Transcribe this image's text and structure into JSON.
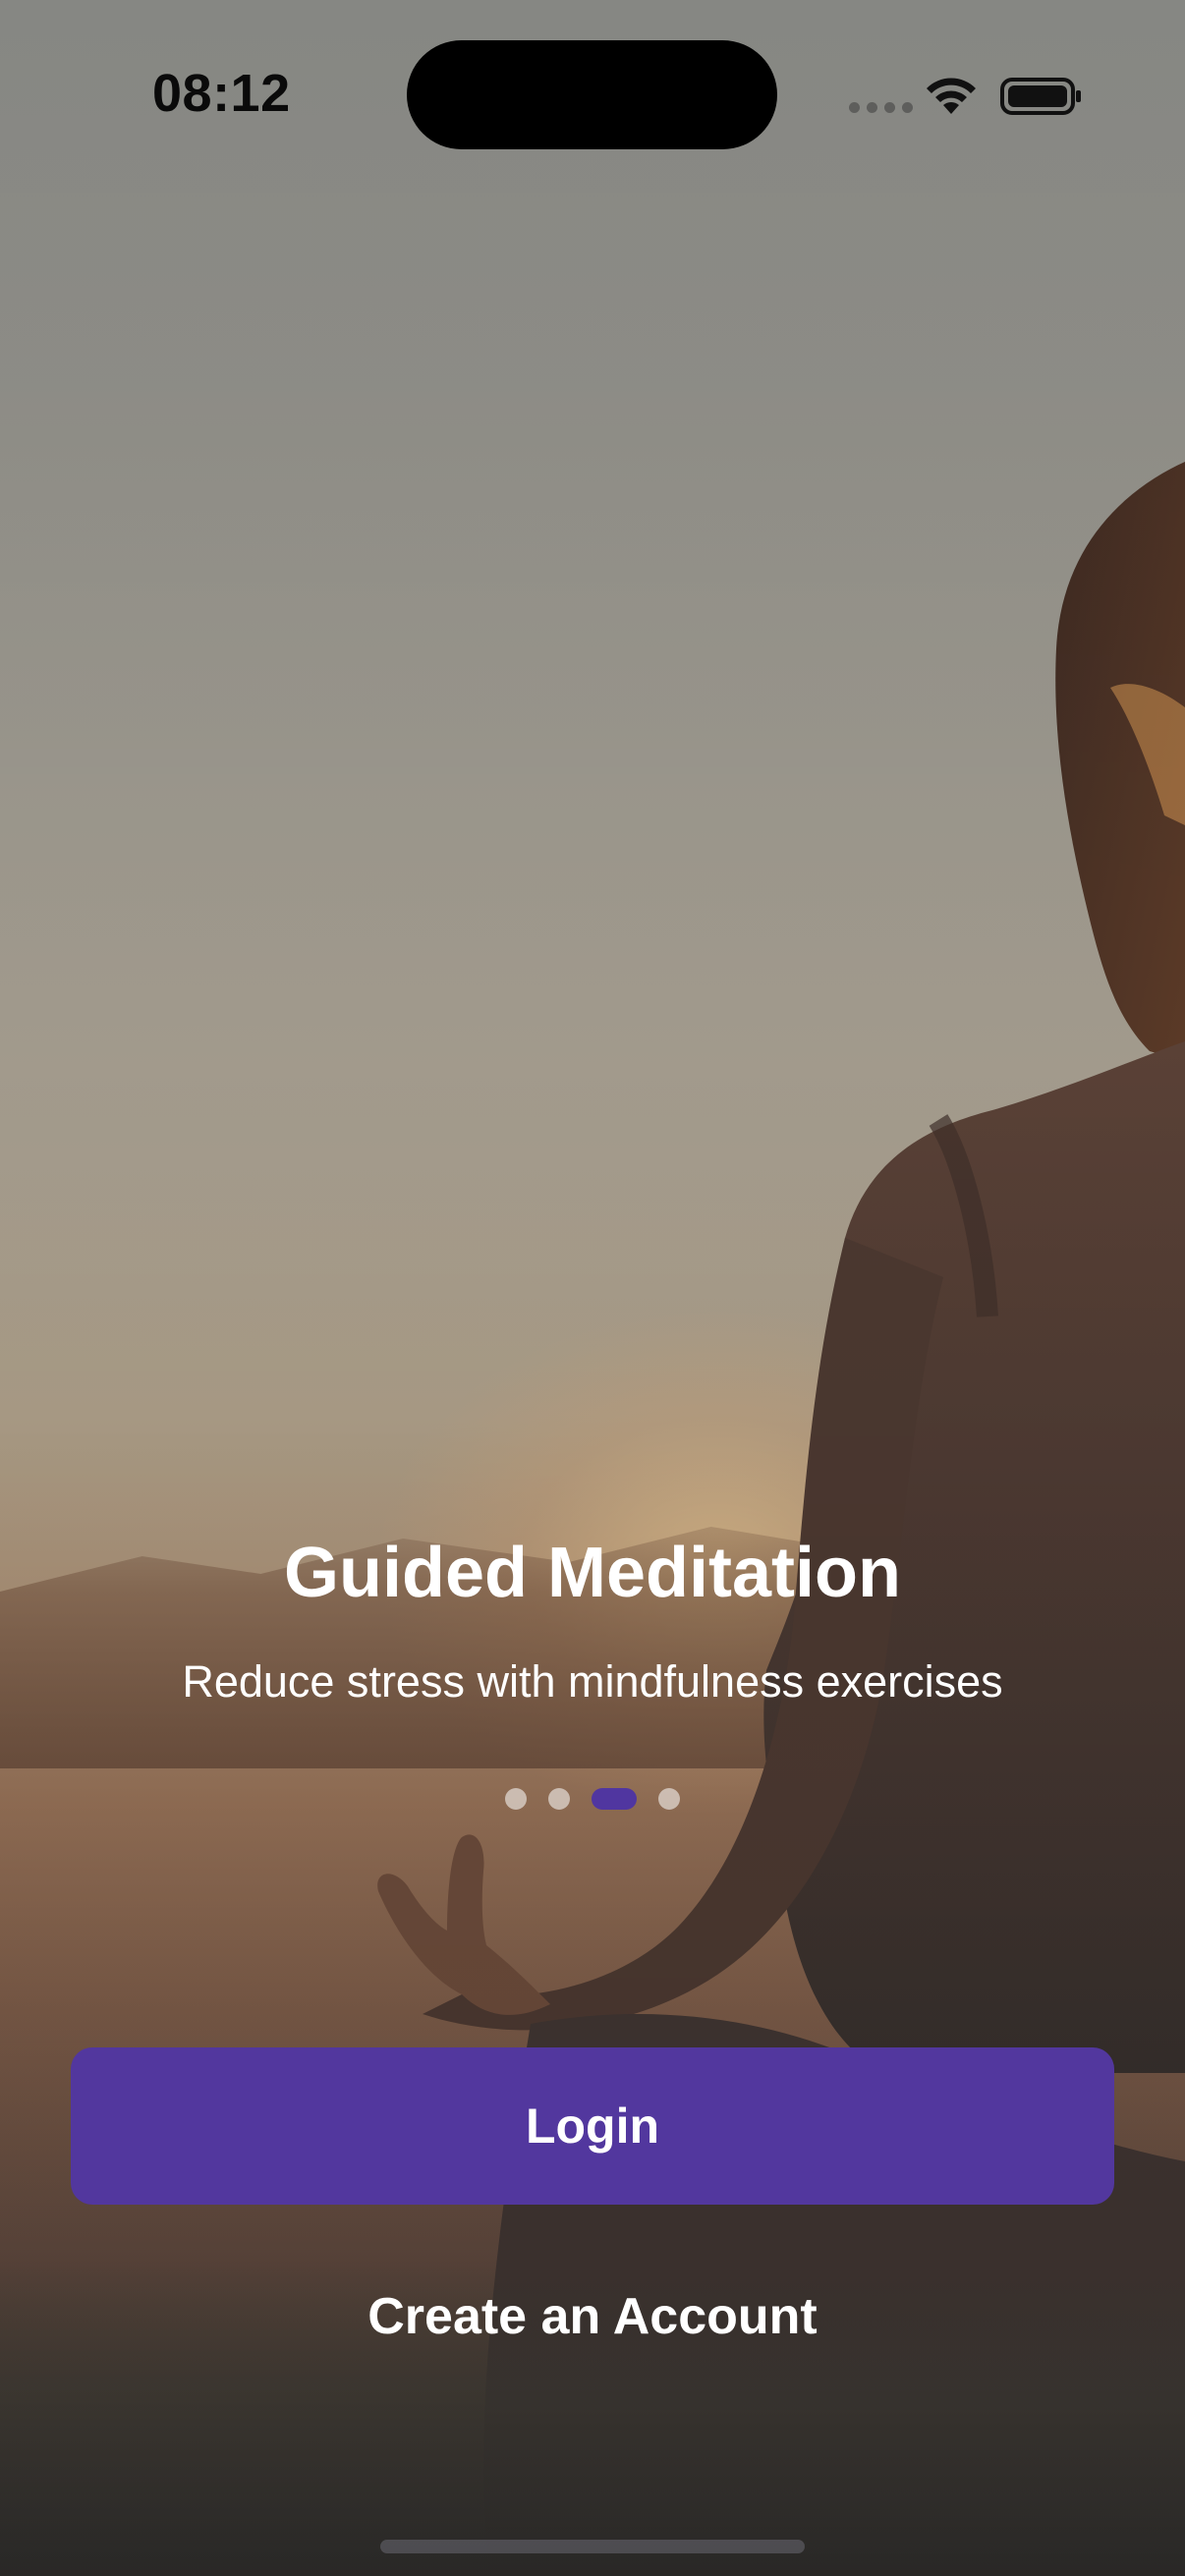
{
  "status_bar": {
    "time": "08:12"
  },
  "onboarding": {
    "title": "Guided Meditation",
    "subtitle": "Reduce stress with mindfulness exercises",
    "pager": {
      "total_pages": 4,
      "active_index": 2
    }
  },
  "actions": {
    "login_label": "Login",
    "create_account_label": "Create an Account"
  },
  "colors": {
    "primary": "#52379e",
    "text": "#ffffff"
  },
  "icons": [
    "wifi-icon",
    "battery-icon",
    "signal-icon"
  ]
}
